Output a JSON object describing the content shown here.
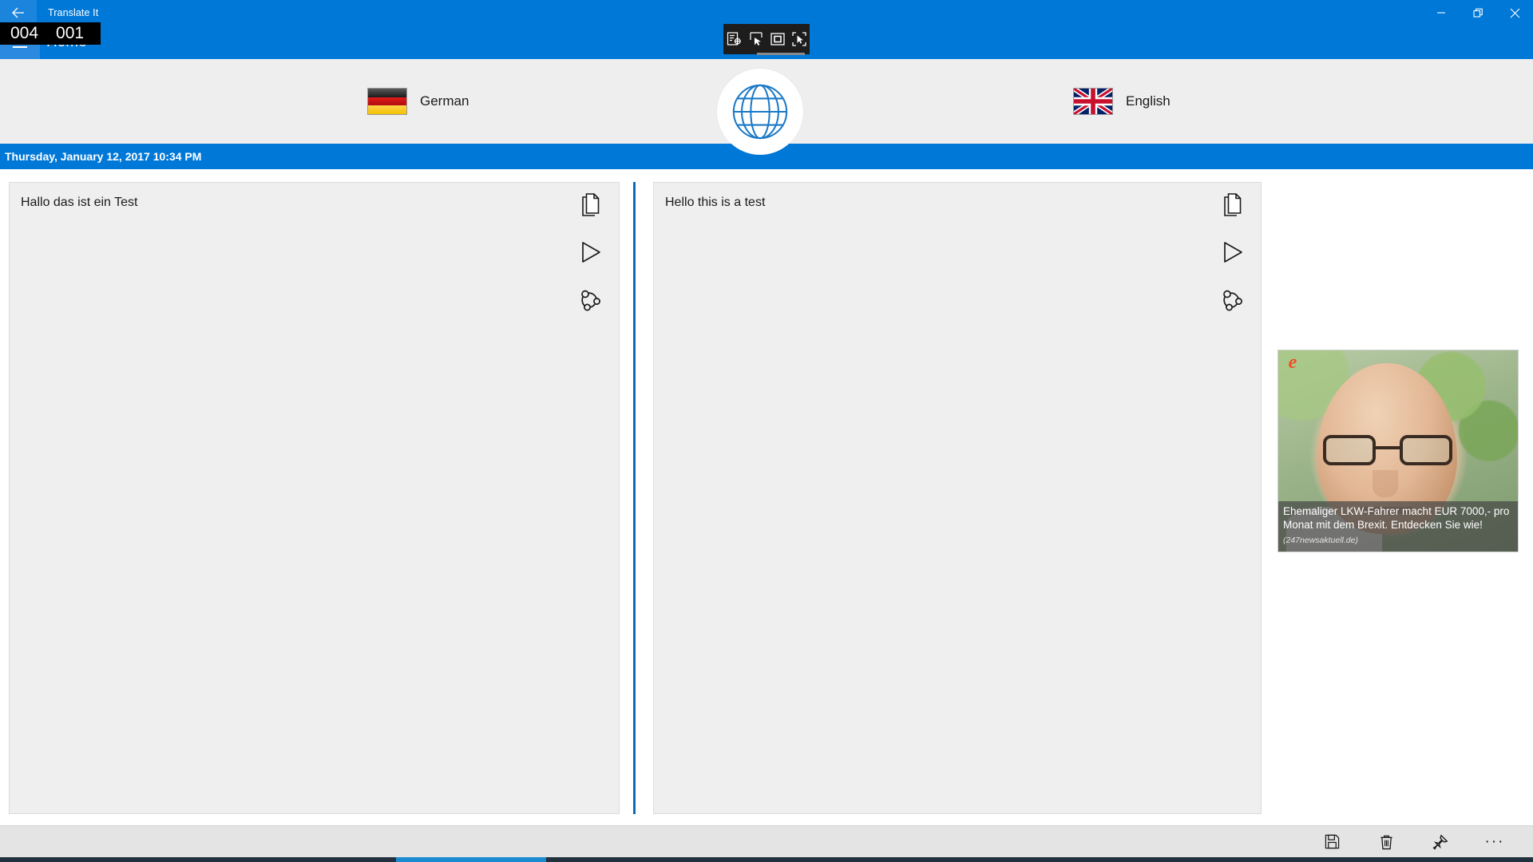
{
  "window": {
    "app_title": "Translate It",
    "back_icon": "back-arrow-icon",
    "minimize_label": "—",
    "restore_label": "❐",
    "close_label": "✕"
  },
  "nav": {
    "menu_icon": "hamburger-icon",
    "home_label": "Home"
  },
  "overlay": {
    "number_left": "004",
    "number_right": "001",
    "inspect_tools": [
      {
        "name": "inspect-properties-icon"
      },
      {
        "name": "cursor-select-icon"
      },
      {
        "name": "highlight-rectangle-icon"
      },
      {
        "name": "capture-region-icon"
      }
    ]
  },
  "languages": {
    "source": {
      "label": "German",
      "flag": "german-flag-icon"
    },
    "target": {
      "label": "English",
      "flag": "uk-flag-icon"
    },
    "swap_icon": "globe-icon"
  },
  "date_bar": {
    "text": "Thursday, January 12, 2017 10:34 PM"
  },
  "panels": {
    "source": {
      "text": "Hallo das ist ein Test",
      "actions": [
        {
          "name": "copy-icon",
          "label": "Copy"
        },
        {
          "name": "play-icon",
          "label": "Speak"
        },
        {
          "name": "share-icon",
          "label": "Share"
        }
      ]
    },
    "target": {
      "text": "Hello this is a test",
      "actions": [
        {
          "name": "copy-icon",
          "label": "Copy"
        },
        {
          "name": "play-icon",
          "label": "Speak"
        },
        {
          "name": "share-icon",
          "label": "Share"
        }
      ]
    }
  },
  "ad": {
    "logo_letter": "e",
    "headline": "Ehemaliger LKW-Fahrer macht EUR 7000,- pro Monat mit dem Brexit. Entdecken Sie wie!",
    "source": "(247newsaktuell.de)"
  },
  "appbar": {
    "actions": [
      {
        "name": "save-icon",
        "label": "Save"
      },
      {
        "name": "delete-icon",
        "label": "Delete"
      },
      {
        "name": "pin-icon",
        "label": "Pin"
      },
      {
        "name": "more-icon",
        "label": "···"
      }
    ]
  },
  "colors": {
    "accent": "#0078d7",
    "panel_bg": "#efefef",
    "divider": "#0d6cb8",
    "appbar_bg": "#e4e4e4",
    "taskbar": "#22313d"
  }
}
